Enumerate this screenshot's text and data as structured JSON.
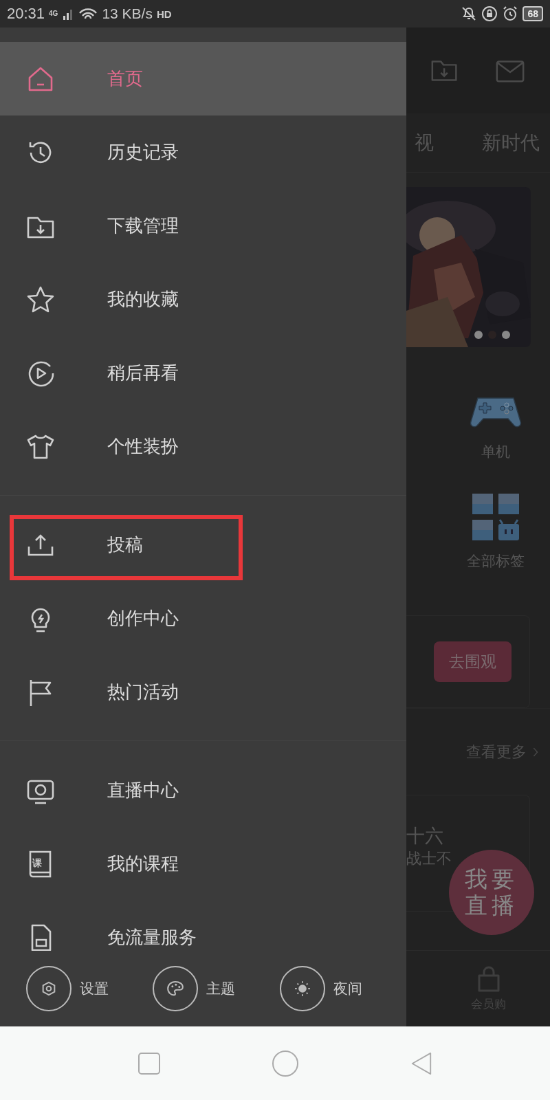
{
  "status_bar": {
    "time": "20:31",
    "network": "4G",
    "speed": "13 KB/s",
    "hd": "HD",
    "battery": "68"
  },
  "drawer": {
    "sections": [
      {
        "items": [
          {
            "label": "首页",
            "kind": "home",
            "selected": true,
            "highlighted": false
          },
          {
            "label": "历史记录",
            "kind": "history",
            "selected": false,
            "highlighted": false
          },
          {
            "label": "下载管理",
            "kind": "download",
            "selected": false,
            "highlighted": false
          },
          {
            "label": "我的收藏",
            "kind": "star",
            "selected": false,
            "highlighted": false
          },
          {
            "label": "稍后再看",
            "kind": "later",
            "selected": false,
            "highlighted": false
          },
          {
            "label": "个性装扮",
            "kind": "shirt",
            "selected": false,
            "highlighted": false
          }
        ]
      },
      {
        "items": [
          {
            "label": "投稿",
            "kind": "upload",
            "selected": false,
            "highlighted": true
          },
          {
            "label": "创作中心",
            "kind": "bulb",
            "selected": false,
            "highlighted": false
          },
          {
            "label": "热门活动",
            "kind": "flag",
            "selected": false,
            "highlighted": false
          }
        ]
      },
      {
        "items": [
          {
            "label": "直播中心",
            "kind": "live",
            "selected": false,
            "highlighted": false
          },
          {
            "label": "我的课程",
            "kind": "course",
            "icon_text": "课",
            "selected": false,
            "highlighted": false
          },
          {
            "label": "免流量服务",
            "kind": "simcard",
            "selected": false,
            "highlighted": false
          }
        ]
      }
    ],
    "bottom_actions": [
      {
        "label": "设置",
        "kind": "settings"
      },
      {
        "label": "主题",
        "kind": "palette"
      },
      {
        "label": "夜间",
        "kind": "sun"
      }
    ]
  },
  "background": {
    "tabs": [
      "视",
      "新时代"
    ],
    "banner": {
      "dots": [
        {
          "selected": false
        },
        {
          "selected": true
        },
        {
          "selected": false
        }
      ]
    },
    "categories": [
      {
        "label": "单机",
        "kind": "gamepad"
      },
      {
        "label": "全部标签",
        "kind": "tags"
      }
    ],
    "watch_button": "去围观",
    "more_link": "查看更多",
    "card_lines": [
      "十六",
      "战士不"
    ],
    "fab": [
      "我要",
      "直播"
    ],
    "bottom_tab": "会员购"
  }
}
